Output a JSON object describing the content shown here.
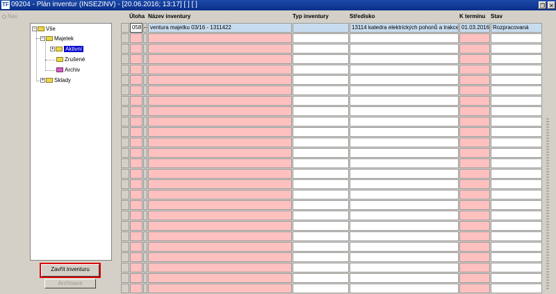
{
  "window": {
    "title": "09204 - Plán inventur (INSEZINV) - [20.06.2016; 13:17] [ ] [ ]",
    "icon_label": "TF"
  },
  "nav": {
    "label": "Nav"
  },
  "tree": {
    "root": "Vše",
    "majetek": "Majetek",
    "aktivni": "Aktivní",
    "zrusene": "Zrušené",
    "archiv": "Archiv",
    "sklady": "Sklady"
  },
  "buttons": {
    "close_inventory": "Zavřít inventuru",
    "archive": "Archivace"
  },
  "grid": {
    "headers": {
      "task": "Úloha",
      "name": "Název inventury",
      "type": "Typ inventury",
      "center": "Středisko",
      "due": "K termínu",
      "status": "Stav"
    },
    "rows": [
      {
        "task": "058",
        "name": "ventura majetku 03/16 - 1311422",
        "type": "",
        "center": "13114 katedra elektrických pohonů a trakce",
        "due": "01.03.2016",
        "status": "Rozpracovaná"
      }
    ],
    "empty_rows": 25
  }
}
